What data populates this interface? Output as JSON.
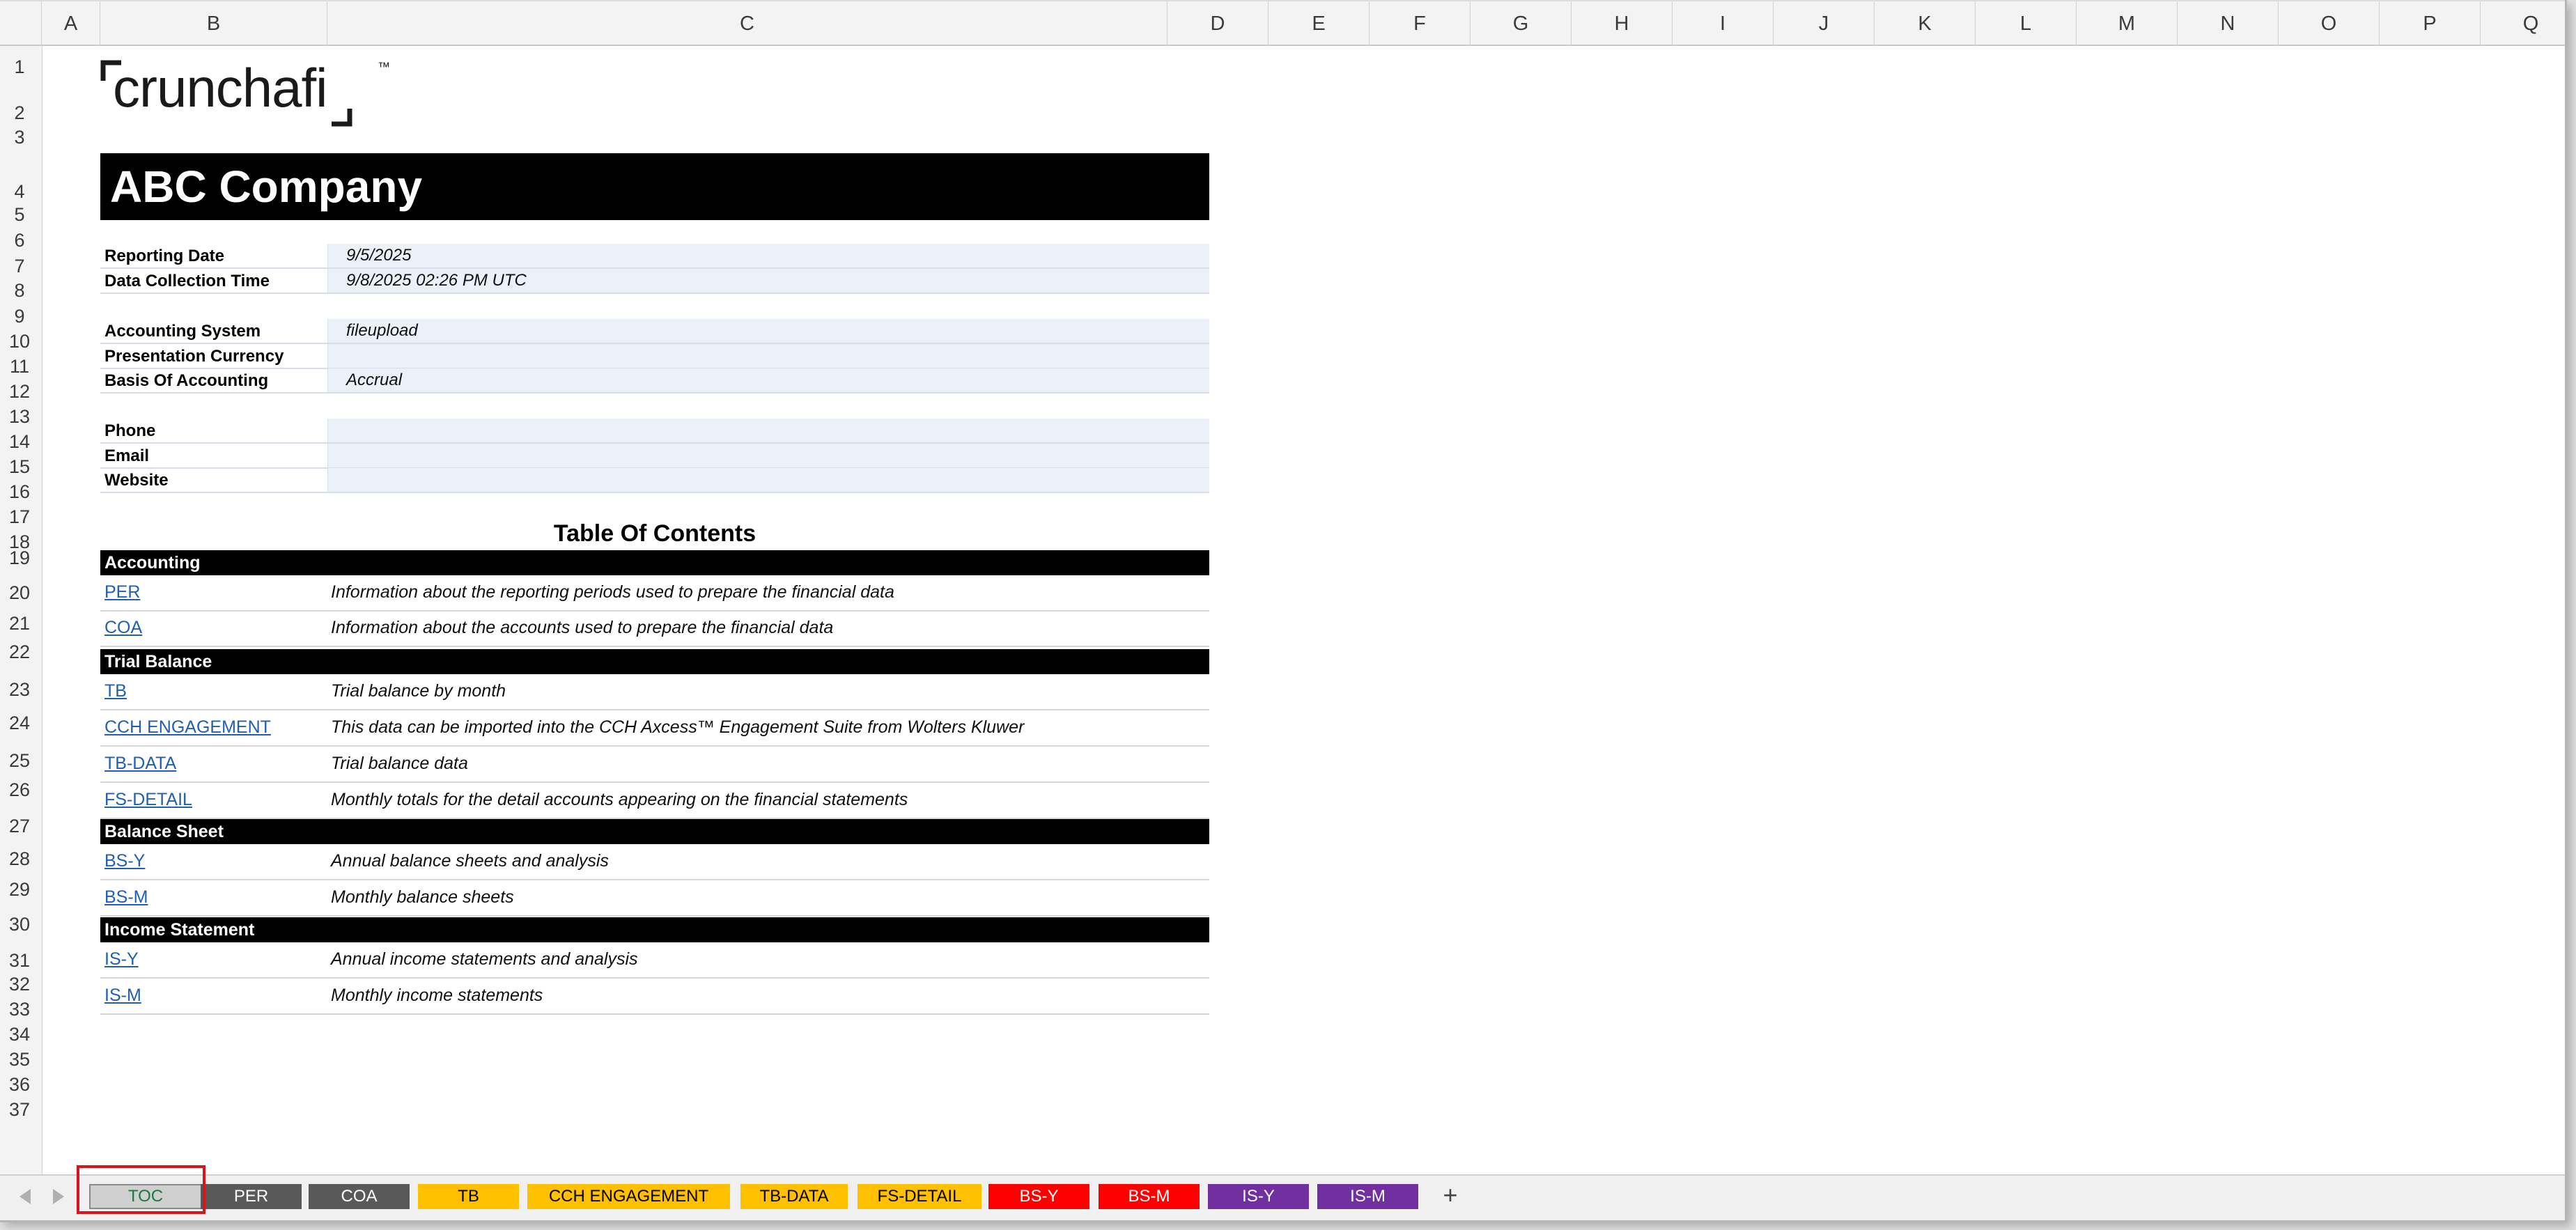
{
  "columns": [
    "A",
    "B",
    "C",
    "D",
    "E",
    "F",
    "G",
    "H",
    "I",
    "J",
    "K",
    "L",
    "M",
    "N",
    "O",
    "P",
    "Q"
  ],
  "rows": [
    "1",
    "2",
    "3",
    "4",
    "5",
    "6",
    "7",
    "8",
    "9",
    "10",
    "11",
    "12",
    "13",
    "14",
    "15",
    "16",
    "17",
    "18",
    "19",
    "20",
    "21",
    "22",
    "23",
    "24",
    "25",
    "26",
    "27",
    "28",
    "29",
    "30",
    "31",
    "32",
    "33",
    "34",
    "35",
    "36",
    "37"
  ],
  "logo": {
    "text": "crunchafi",
    "tm": "™"
  },
  "company": "ABC Company",
  "info": [
    {
      "label": "Reporting Date",
      "value": "9/5/2025"
    },
    {
      "label": "Data Collection Time",
      "value": "9/8/2025 02:26 PM UTC"
    },
    {
      "label": "Accounting System",
      "value": "fileupload"
    },
    {
      "label": "Presentation Currency",
      "value": ""
    },
    {
      "label": "Basis Of Accounting",
      "value": "Accrual"
    },
    {
      "label": "Phone",
      "value": ""
    },
    {
      "label": "Email",
      "value": ""
    },
    {
      "label": "Website",
      "value": ""
    }
  ],
  "toc_title": "Table Of Contents",
  "sections": [
    {
      "title": "Accounting",
      "items": [
        {
          "link": "PER",
          "desc": "Information about the reporting periods used to prepare the financial data"
        },
        {
          "link": "COA",
          "desc": "Information about the accounts used to prepare the financial data"
        }
      ]
    },
    {
      "title": "Trial Balance",
      "items": [
        {
          "link": "TB",
          "desc": "Trial balance by month"
        },
        {
          "link": "CCH ENGAGEMENT",
          "desc": "This data can be imported into the CCH Axcess™ Engagement Suite from Wolters Kluwer"
        },
        {
          "link": "TB-DATA",
          "desc": "Trial balance data"
        },
        {
          "link": "FS-DETAIL",
          "desc": "Monthly totals for the detail accounts appearing on the financial statements"
        }
      ]
    },
    {
      "title": "Balance Sheet",
      "items": [
        {
          "link": "BS-Y",
          "desc": "Annual balance sheets and analysis"
        },
        {
          "link": "BS-M",
          "desc": "Monthly balance sheets"
        }
      ]
    },
    {
      "title": "Income Statement",
      "items": [
        {
          "link": "IS-Y",
          "desc": "Annual income statements and analysis"
        },
        {
          "link": "IS-M",
          "desc": "Monthly income statements"
        }
      ]
    }
  ],
  "sheet_tabs": [
    {
      "label": "TOC",
      "color": "#cfcfcf",
      "text_color": "#1a7a3c",
      "active": true
    },
    {
      "label": "PER",
      "color": "#595959",
      "text_color": "#ffffff"
    },
    {
      "label": "COA",
      "color": "#595959",
      "text_color": "#ffffff"
    },
    {
      "label": "TB",
      "color": "#ffc000",
      "text_color": "#000000"
    },
    {
      "label": "CCH ENGAGEMENT",
      "color": "#ffc000",
      "text_color": "#000000"
    },
    {
      "label": "TB-DATA",
      "color": "#ffc000",
      "text_color": "#000000"
    },
    {
      "label": "FS-DETAIL",
      "color": "#ffc000",
      "text_color": "#000000"
    },
    {
      "label": "BS-Y",
      "color": "#ff0000",
      "text_color": "#ffffff"
    },
    {
      "label": "BS-M",
      "color": "#ff0000",
      "text_color": "#ffffff"
    },
    {
      "label": "IS-Y",
      "color": "#7030a0",
      "text_color": "#ffffff"
    },
    {
      "label": "IS-M",
      "color": "#7030a0",
      "text_color": "#ffffff"
    }
  ],
  "add_sheet": "+"
}
